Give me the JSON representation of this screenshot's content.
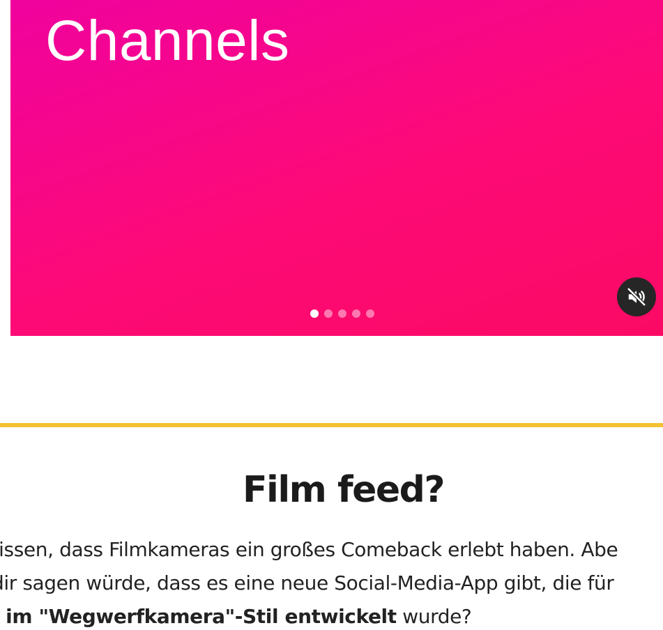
{
  "media": {
    "title": "Channels",
    "carousel_count": 5,
    "carousel_active": 0,
    "mute_icon": "speaker-muted-icon",
    "colors": {
      "background": "#fd0a77",
      "mute_button": "#262626"
    }
  },
  "divider": {
    "color": "#f2c230"
  },
  "article": {
    "heading": "Film feed?",
    "line1": "vissen, dass Filmkameras ein großes Comeback erlebt haben. Abe",
    "line2": "dir sagen würde, dass es eine neue Social-Media-App gibt, die für",
    "line3_bold": "; im \"Wegwerfkamera\"-Stil entwickelt",
    "line3_rest": " wurde?"
  }
}
